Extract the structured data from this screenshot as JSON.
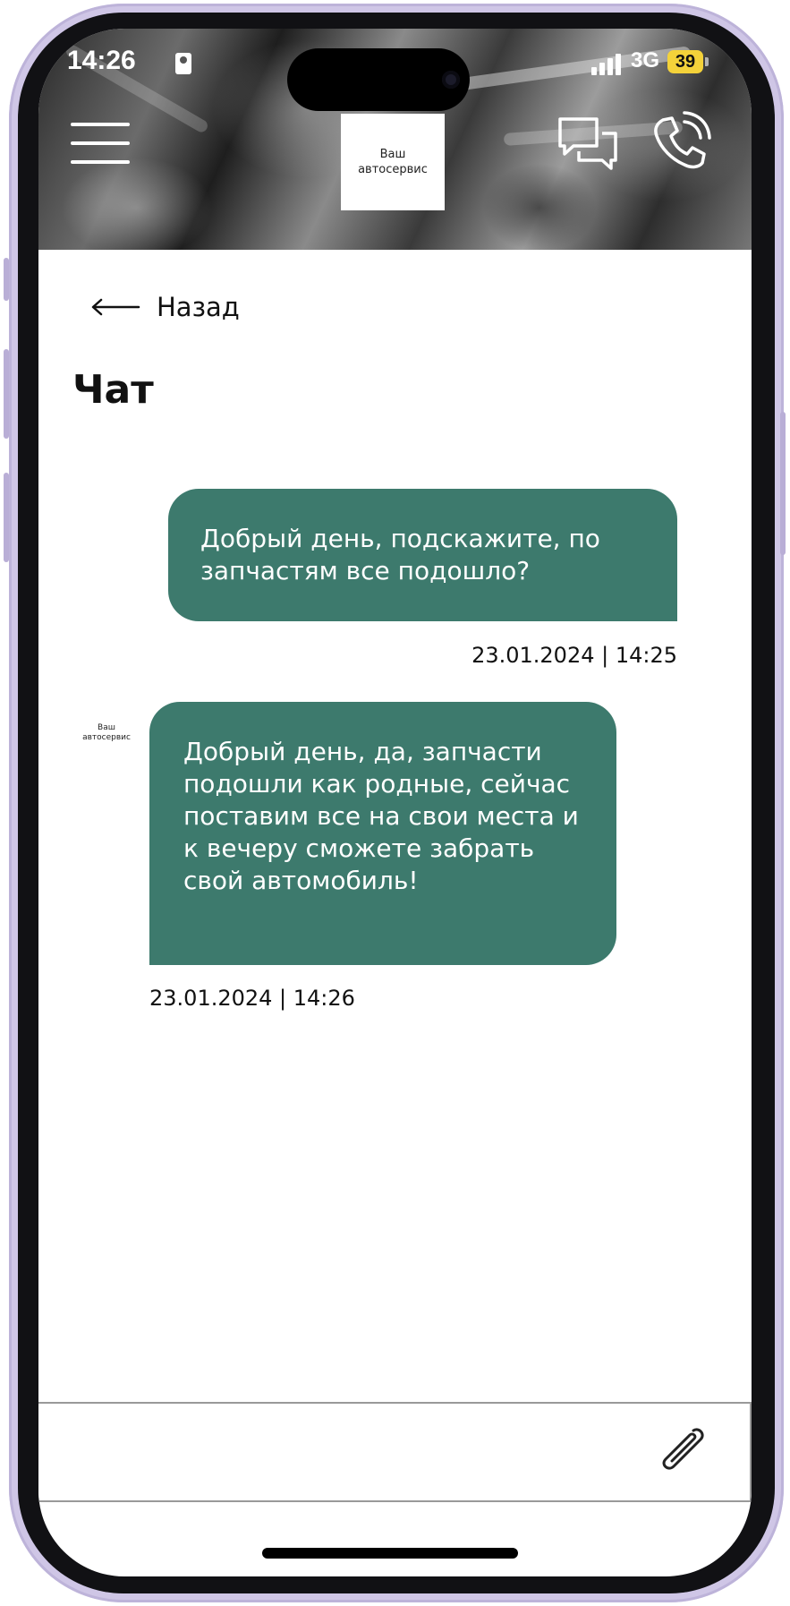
{
  "status_bar": {
    "time": "14:26",
    "network": "3G",
    "battery": "39"
  },
  "header": {
    "logo_text": "Ваш\nавтосервис"
  },
  "nav": {
    "back_label": "Назад"
  },
  "page": {
    "title": "Чат"
  },
  "messages": [
    {
      "direction": "outgoing",
      "text": "Добрый день, подскажите, по запчастям все подошло?",
      "timestamp": "23.01.2024 | 14:25"
    },
    {
      "direction": "incoming",
      "sender": "Ваш автосервис",
      "text": "Добрый день, да, запчасти подошли как родные, сейчас поставим все на свои места и к вечеру сможете забрать свой автомобиль!",
      "timestamp": "23.01.2024 | 14:26"
    }
  ],
  "composer": {
    "value": "",
    "placeholder": ""
  },
  "colors": {
    "bubble": "#3d7a6d",
    "battery": "#f4d23a"
  },
  "icons": [
    "menu-icon",
    "chat-icon",
    "phone-icon",
    "back-arrow-icon",
    "paperclip-icon"
  ]
}
